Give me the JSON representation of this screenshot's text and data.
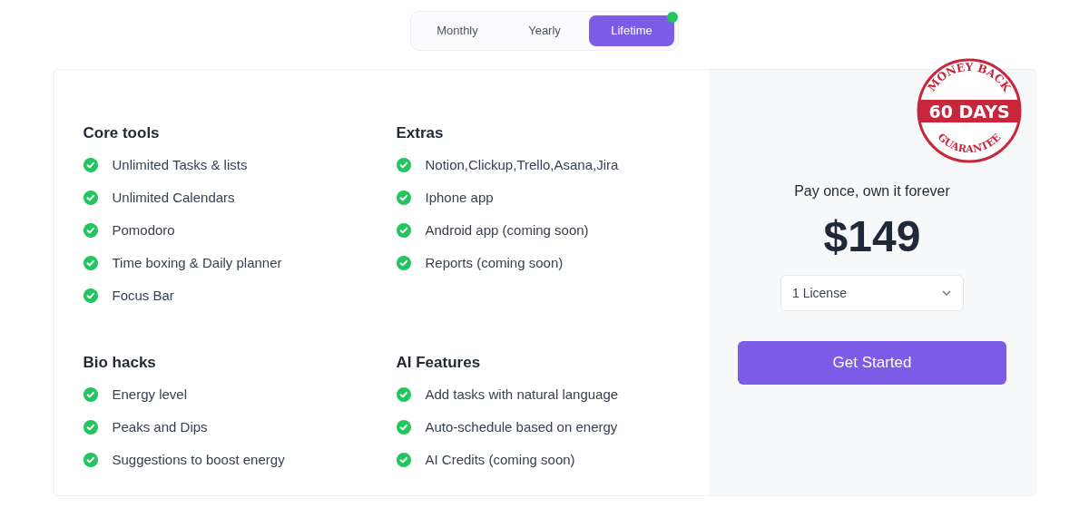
{
  "billing_tabs": [
    {
      "label": "Monthly",
      "selected": false
    },
    {
      "label": "Yearly",
      "selected": false
    },
    {
      "label": "Lifetime",
      "selected": true
    }
  ],
  "feature_groups": [
    {
      "title": "Core tools",
      "items": [
        "Unlimited Tasks & lists",
        "Unlimited Calendars",
        "Pomodoro",
        "Time boxing & Daily planner",
        "Focus Bar"
      ]
    },
    {
      "title": "Extras",
      "items": [
        "Notion,Clickup,Trello,Asana,Jira",
        "Iphone app",
        "Android app (coming soon)",
        "Reports (coming soon)"
      ]
    },
    {
      "title": "Bio hacks",
      "items": [
        "Energy level",
        "Peaks and Dips",
        "Suggestions to boost energy"
      ]
    },
    {
      "title": "AI Features",
      "items": [
        "Add tasks with natural language",
        "Auto-schedule based on energy",
        "AI Credits (coming soon)"
      ]
    }
  ],
  "pricing": {
    "tagline": "Pay once, own it forever",
    "price": "$149",
    "license_select": "1 License",
    "button": "Get Started"
  },
  "stamp": {
    "top": "MONEY BACK",
    "middle": "60 DAYS",
    "bottom": "GUARANTEE"
  }
}
